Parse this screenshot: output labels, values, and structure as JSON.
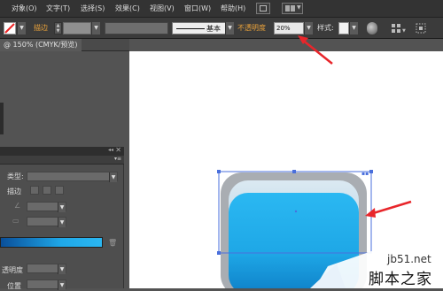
{
  "menubar": {
    "items": [
      "对象(O)",
      "文字(T)",
      "选择(S)",
      "效果(C)",
      "视图(V)",
      "窗口(W)",
      "帮助(H)"
    ]
  },
  "control": {
    "stroke_label": "描边",
    "stroke_style_label": "基本",
    "opacity_label": "不透明度",
    "opacity_value": "20%",
    "style_label": "样式:"
  },
  "document": {
    "tab_label": "@ 150% (CMYK/预览)"
  },
  "gradient_panel": {
    "type_label": "类型:",
    "stroke_label": "描边",
    "opacity_label": "透明度",
    "position_label": "位置"
  },
  "watermark": {
    "site": "jb51.net",
    "text": "脚本之家"
  },
  "colors": {
    "accent_orange": "#e9a23b",
    "arrow_red": "#e8262b",
    "button_blue": "#1fa8e8",
    "selection_blue": "#4a6fdc"
  }
}
